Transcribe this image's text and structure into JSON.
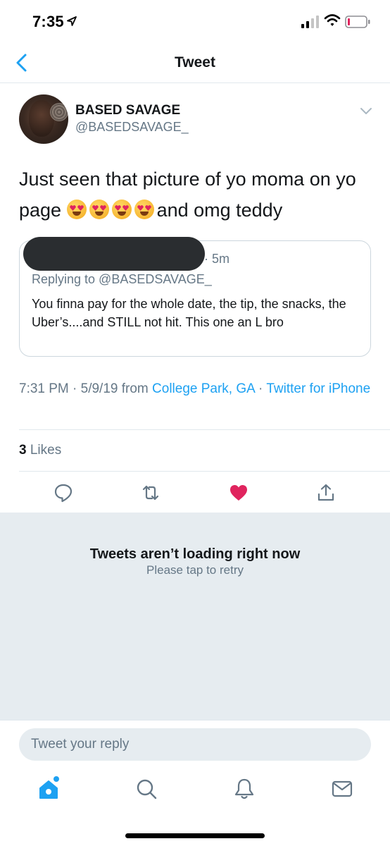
{
  "status_bar": {
    "time": "7:35"
  },
  "nav": {
    "title": "Tweet"
  },
  "author": {
    "display_name": "BASED SAVAGE",
    "handle": "@BASEDSAVAGE_"
  },
  "tweet": {
    "text_before_emoji": "Just seen that picture of yo moma on yo page ",
    "emoji_count": 4,
    "emoji_name": "heart-eyes-emoji",
    "text_after_emoji": "and omg teddy"
  },
  "quoted_reply": {
    "time": "· 5m",
    "replying_to": "Replying to @BASEDSAVAGE_",
    "text": "You finna pay for the whole date, the tip, the snacks, the Uber’s....and STILL not hit. This one an L bro"
  },
  "meta": {
    "timestamp": "7:31 PM · 5/9/19 from ",
    "location": "College Park, GA",
    "separator": " · ",
    "source": "Twitter for iPhone"
  },
  "stats": {
    "likes_count": "3",
    "likes_label": " Likes"
  },
  "actions": {
    "like_color": "#e0245e"
  },
  "error": {
    "title": "Tweets aren’t loading right now",
    "subtitle": "Please tap to retry"
  },
  "reply": {
    "placeholder": "Tweet your reply"
  },
  "colors": {
    "accent": "#1da1f2",
    "secondary_text": "#657786",
    "battery_low": "#e0245e"
  }
}
